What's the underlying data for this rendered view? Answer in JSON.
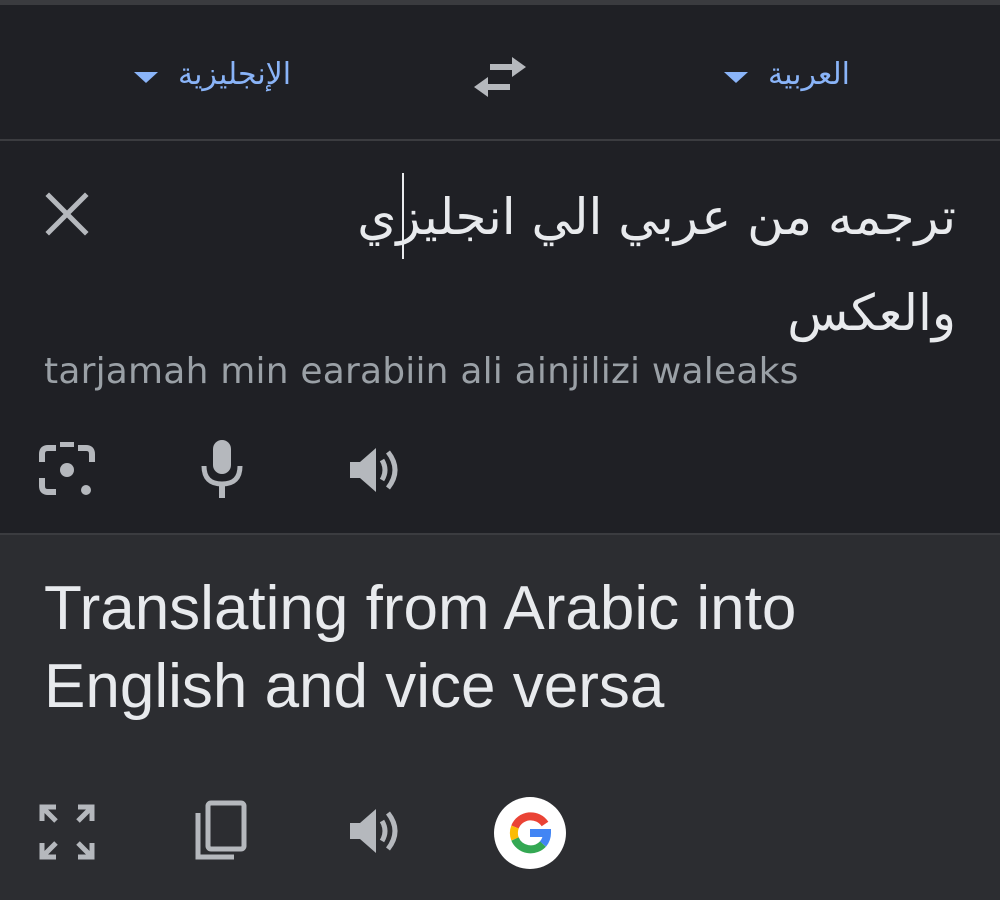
{
  "languages": {
    "source": "العربية",
    "target": "الإنجليزية"
  },
  "input": {
    "text": "ترجمه من عربي الي انجليزي والعكس",
    "transliteration": "tarjamah min earabiin ali ainjilizi waleaks"
  },
  "output": {
    "translation": "Translating from Arabic into English and vice versa"
  },
  "icons": {
    "swap": "swap-arrows-icon",
    "clear": "close-icon",
    "camera": "camera-lens-icon",
    "mic": "microphone-icon",
    "speak": "speaker-icon",
    "expand": "fullscreen-icon",
    "copy": "copy-icon",
    "google": "google-logo"
  },
  "colors": {
    "background": "#1f2025",
    "output_background": "#2c2d31",
    "accent": "#8ab4f8",
    "text": "#e8eaed",
    "secondary_text": "#9aa0a6",
    "icon": "#b5b8bd"
  }
}
